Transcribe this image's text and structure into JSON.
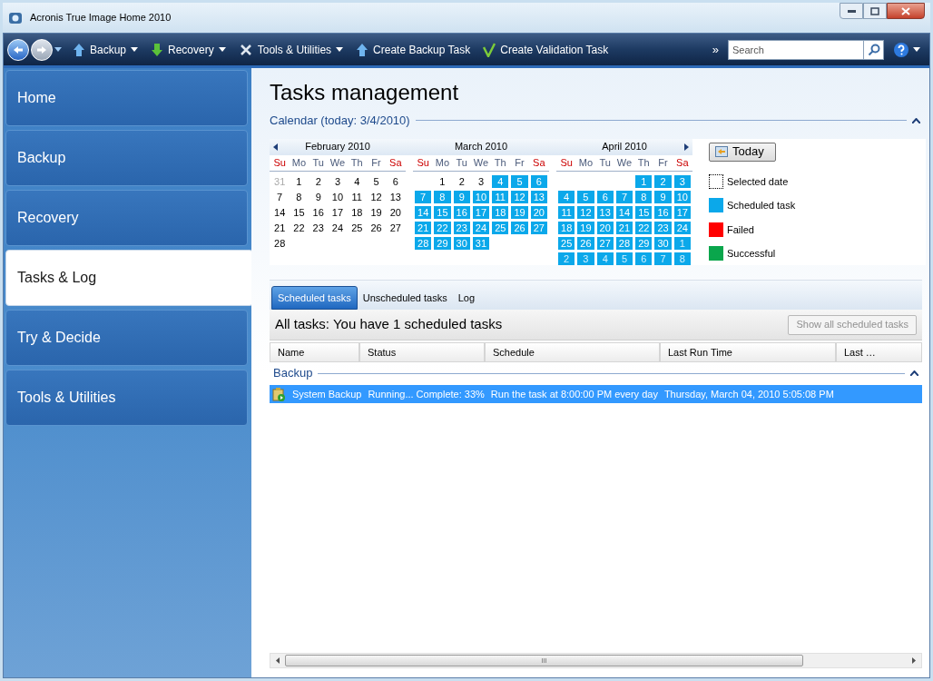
{
  "window": {
    "title": "Acronis True Image Home 2010"
  },
  "toolbar": {
    "items": [
      {
        "label": "Backup",
        "kind": "menu"
      },
      {
        "label": "Recovery",
        "kind": "menu"
      },
      {
        "label": "Tools & Utilities",
        "kind": "menu"
      },
      {
        "label": "Create Backup Task",
        "kind": "action"
      },
      {
        "label": "Create Validation Task",
        "kind": "action"
      }
    ],
    "overflow": "»",
    "search": {
      "placeholder": "Search"
    }
  },
  "sidebar": {
    "items": [
      {
        "label": "Home",
        "selected": false
      },
      {
        "label": "Backup",
        "selected": false
      },
      {
        "label": "Recovery",
        "selected": false
      },
      {
        "label": "Tasks & Log",
        "selected": true
      },
      {
        "label": "Try & Decide",
        "selected": false
      },
      {
        "label": "Tools & Utilities",
        "selected": false
      }
    ]
  },
  "page_title": "Tasks management",
  "calendar": {
    "title": "Calendar (today: 3/4/2010)",
    "months": [
      {
        "name": "February 2010",
        "weekdays": [
          "Su",
          "Mo",
          "Tu",
          "We",
          "Th",
          "Fr",
          "Sa"
        ],
        "weeks": [
          [
            {
              "d": "31",
              "kind": "other",
              "scheduled": false
            },
            {
              "d": "1",
              "kind": "day",
              "scheduled": false
            },
            {
              "d": "2",
              "kind": "day",
              "scheduled": false
            },
            {
              "d": "3",
              "kind": "day",
              "scheduled": false
            },
            {
              "d": "4",
              "kind": "day",
              "scheduled": false
            },
            {
              "d": "5",
              "kind": "day",
              "scheduled": false
            },
            {
              "d": "6",
              "kind": "day",
              "scheduled": false
            }
          ],
          [
            {
              "d": "7",
              "kind": "day",
              "scheduled": false
            },
            {
              "d": "8",
              "kind": "day",
              "scheduled": false
            },
            {
              "d": "9",
              "kind": "day",
              "scheduled": false
            },
            {
              "d": "10",
              "kind": "day",
              "scheduled": false
            },
            {
              "d": "11",
              "kind": "day",
              "scheduled": false
            },
            {
              "d": "12",
              "kind": "day",
              "scheduled": false
            },
            {
              "d": "13",
              "kind": "day",
              "scheduled": false
            }
          ],
          [
            {
              "d": "14",
              "kind": "day",
              "scheduled": false
            },
            {
              "d": "15",
              "kind": "day",
              "scheduled": false
            },
            {
              "d": "16",
              "kind": "day",
              "scheduled": false
            },
            {
              "d": "17",
              "kind": "day",
              "scheduled": false
            },
            {
              "d": "18",
              "kind": "day",
              "scheduled": false
            },
            {
              "d": "19",
              "kind": "day",
              "scheduled": false
            },
            {
              "d": "20",
              "kind": "day",
              "scheduled": false
            }
          ],
          [
            {
              "d": "21",
              "kind": "day",
              "scheduled": false
            },
            {
              "d": "22",
              "kind": "day",
              "scheduled": false
            },
            {
              "d": "23",
              "kind": "day",
              "scheduled": false
            },
            {
              "d": "24",
              "kind": "day",
              "scheduled": false
            },
            {
              "d": "25",
              "kind": "day",
              "scheduled": false
            },
            {
              "d": "26",
              "kind": "day",
              "scheduled": false
            },
            {
              "d": "27",
              "kind": "day",
              "scheduled": false
            }
          ],
          [
            {
              "d": "28",
              "kind": "day",
              "scheduled": false
            }
          ]
        ]
      },
      {
        "name": "March 2010",
        "weekdays": [
          "Su",
          "Mo",
          "Tu",
          "We",
          "Th",
          "Fr",
          "Sa"
        ],
        "weeks": [
          [
            {
              "kind": "blank"
            },
            {
              "d": "1",
              "kind": "day",
              "scheduled": false
            },
            {
              "d": "2",
              "kind": "day",
              "scheduled": false
            },
            {
              "d": "3",
              "kind": "day",
              "scheduled": false
            },
            {
              "d": "4",
              "kind": "day",
              "scheduled": true
            },
            {
              "d": "5",
              "kind": "day",
              "scheduled": true
            },
            {
              "d": "6",
              "kind": "day",
              "scheduled": true
            }
          ],
          [
            {
              "d": "7",
              "kind": "day",
              "scheduled": true
            },
            {
              "d": "8",
              "kind": "day",
              "scheduled": true
            },
            {
              "d": "9",
              "kind": "day",
              "scheduled": true
            },
            {
              "d": "10",
              "kind": "day",
              "scheduled": true
            },
            {
              "d": "11",
              "kind": "day",
              "scheduled": true
            },
            {
              "d": "12",
              "kind": "day",
              "scheduled": true
            },
            {
              "d": "13",
              "kind": "day",
              "scheduled": true
            }
          ],
          [
            {
              "d": "14",
              "kind": "day",
              "scheduled": true
            },
            {
              "d": "15",
              "kind": "day",
              "scheduled": true
            },
            {
              "d": "16",
              "kind": "day",
              "scheduled": true
            },
            {
              "d": "17",
              "kind": "day",
              "scheduled": true
            },
            {
              "d": "18",
              "kind": "day",
              "scheduled": true
            },
            {
              "d": "19",
              "kind": "day",
              "scheduled": true
            },
            {
              "d": "20",
              "kind": "day",
              "scheduled": true
            }
          ],
          [
            {
              "d": "21",
              "kind": "day",
              "scheduled": true
            },
            {
              "d": "22",
              "kind": "day",
              "scheduled": true
            },
            {
              "d": "23",
              "kind": "day",
              "scheduled": true
            },
            {
              "d": "24",
              "kind": "day",
              "scheduled": true
            },
            {
              "d": "25",
              "kind": "day",
              "scheduled": true
            },
            {
              "d": "26",
              "kind": "day",
              "scheduled": true
            },
            {
              "d": "27",
              "kind": "day",
              "scheduled": true
            }
          ],
          [
            {
              "d": "28",
              "kind": "day",
              "scheduled": true
            },
            {
              "d": "29",
              "kind": "day",
              "scheduled": true
            },
            {
              "d": "30",
              "kind": "day",
              "scheduled": true
            },
            {
              "d": "31",
              "kind": "day",
              "scheduled": true
            }
          ]
        ]
      },
      {
        "name": "April 2010",
        "weekdays": [
          "Su",
          "Mo",
          "Tu",
          "We",
          "Th",
          "Fr",
          "Sa"
        ],
        "weeks": [
          [
            {
              "kind": "blank"
            },
            {
              "kind": "blank"
            },
            {
              "kind": "blank"
            },
            {
              "kind": "blank"
            },
            {
              "d": "1",
              "kind": "day",
              "scheduled": true
            },
            {
              "d": "2",
              "kind": "day",
              "scheduled": true
            },
            {
              "d": "3",
              "kind": "day",
              "scheduled": true
            }
          ],
          [
            {
              "d": "4",
              "kind": "day",
              "scheduled": true
            },
            {
              "d": "5",
              "kind": "day",
              "scheduled": true
            },
            {
              "d": "6",
              "kind": "day",
              "scheduled": true
            },
            {
              "d": "7",
              "kind": "day",
              "scheduled": true
            },
            {
              "d": "8",
              "kind": "day",
              "scheduled": true
            },
            {
              "d": "9",
              "kind": "day",
              "scheduled": true
            },
            {
              "d": "10",
              "kind": "day",
              "scheduled": true
            }
          ],
          [
            {
              "d": "11",
              "kind": "day",
              "scheduled": true
            },
            {
              "d": "12",
              "kind": "day",
              "scheduled": true
            },
            {
              "d": "13",
              "kind": "day",
              "scheduled": true
            },
            {
              "d": "14",
              "kind": "day",
              "scheduled": true
            },
            {
              "d": "15",
              "kind": "day",
              "scheduled": true
            },
            {
              "d": "16",
              "kind": "day",
              "scheduled": true
            },
            {
              "d": "17",
              "kind": "day",
              "scheduled": true
            }
          ],
          [
            {
              "d": "18",
              "kind": "day",
              "scheduled": true
            },
            {
              "d": "19",
              "kind": "day",
              "scheduled": true
            },
            {
              "d": "20",
              "kind": "day",
              "scheduled": true
            },
            {
              "d": "21",
              "kind": "day",
              "scheduled": true
            },
            {
              "d": "22",
              "kind": "day",
              "scheduled": true
            },
            {
              "d": "23",
              "kind": "day",
              "scheduled": true
            },
            {
              "d": "24",
              "kind": "day",
              "scheduled": true
            }
          ],
          [
            {
              "d": "25",
              "kind": "day",
              "scheduled": true
            },
            {
              "d": "26",
              "kind": "day",
              "scheduled": true
            },
            {
              "d": "27",
              "kind": "day",
              "scheduled": true
            },
            {
              "d": "28",
              "kind": "day",
              "scheduled": true
            },
            {
              "d": "29",
              "kind": "day",
              "scheduled": true
            },
            {
              "d": "30",
              "kind": "day",
              "scheduled": true
            },
            {
              "d": "1",
              "kind": "other",
              "scheduled": true
            }
          ],
          [
            {
              "d": "2",
              "kind": "other",
              "scheduled": true
            },
            {
              "d": "3",
              "kind": "other",
              "scheduled": true
            },
            {
              "d": "4",
              "kind": "other",
              "scheduled": true
            },
            {
              "d": "5",
              "kind": "other",
              "scheduled": true
            },
            {
              "d": "6",
              "kind": "other",
              "scheduled": true
            },
            {
              "d": "7",
              "kind": "other",
              "scheduled": true
            },
            {
              "d": "8",
              "kind": "other",
              "scheduled": true
            }
          ]
        ]
      }
    ],
    "today_button": "Today",
    "legend": [
      {
        "label": "Selected date",
        "kind": "outline"
      },
      {
        "label": "Scheduled task",
        "kind": "fill",
        "color": "#0ba8ea"
      },
      {
        "label": "Failed",
        "kind": "fill",
        "color": "#ff0000"
      },
      {
        "label": "Successful",
        "kind": "fill",
        "color": "#0aa64c"
      }
    ]
  },
  "tabs": [
    {
      "label": "Scheduled tasks",
      "selected": true
    },
    {
      "label": "Unscheduled tasks",
      "selected": false
    },
    {
      "label": "Log",
      "selected": false
    }
  ],
  "summary": "All tasks: You have 1 scheduled tasks",
  "show_all_button": {
    "label": "Show all scheduled tasks",
    "disabled": true
  },
  "table": {
    "columns": [
      "Name",
      "Status",
      "Schedule",
      "Last Run Time",
      "Last …"
    ],
    "group": "Backup",
    "rows": [
      {
        "cells": [
          "System Backup",
          "Running... Complete: 33%",
          "Run the task at 8:00:00 PM every day",
          "Thursday, March 04, 2010 5:05:08 PM"
        ],
        "selected": true
      }
    ]
  },
  "scrollbar": {
    "grip": "III"
  }
}
